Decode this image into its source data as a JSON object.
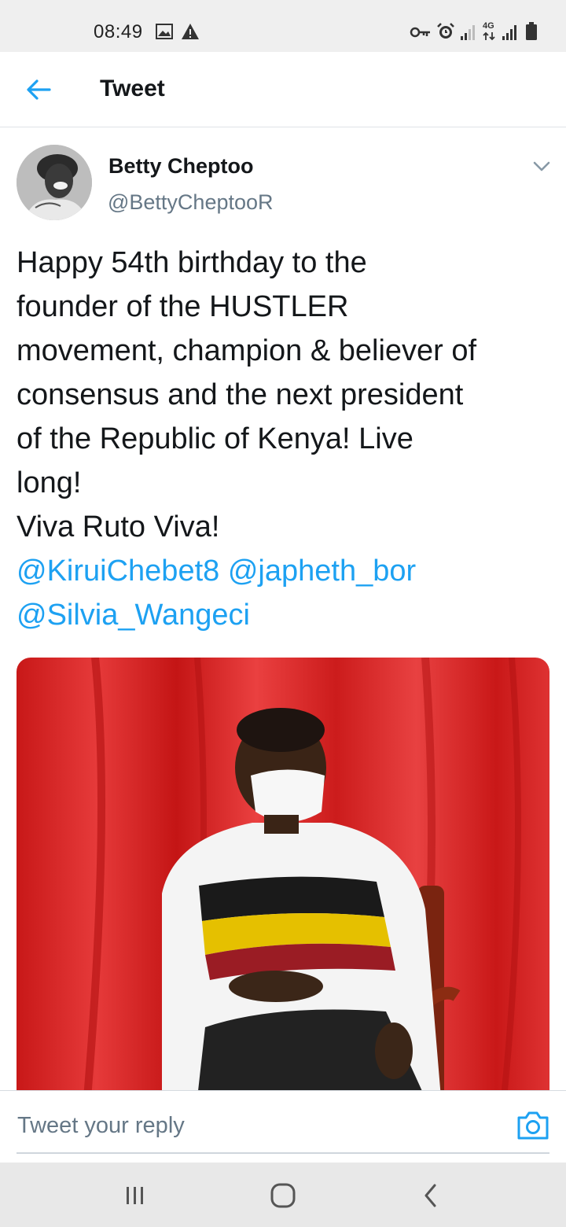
{
  "status_bar": {
    "time": "08:49",
    "network_label": "4G",
    "icons": [
      "image-icon",
      "alert-icon",
      "key-icon",
      "alarm-icon",
      "signal-icon",
      "network-4g-icon",
      "signal-icon",
      "battery-icon"
    ]
  },
  "header": {
    "title": "Tweet",
    "back_icon": "arrow-left-icon"
  },
  "tweet": {
    "author_name": "Betty Cheptoo",
    "author_handle": "@BettyCheptooR",
    "text_lines": [
      "Happy 54th birthday to the",
      "founder of the HUSTLER",
      "movement, champion & believer of",
      "consensus and the next president",
      "of the Republic of Kenya! Live",
      "long!",
      "Viva Ruto Viva!"
    ],
    "mentions": [
      "@KiruiChebet8",
      "@japheth_bor",
      "@Silvia_Wangeci"
    ],
    "menu_icon": "chevron-down-icon"
  },
  "reply": {
    "placeholder": "Tweet your reply",
    "camera_icon": "camera-icon"
  },
  "nav": {
    "icons": [
      "recents-icon",
      "home-icon",
      "back-icon"
    ]
  },
  "colors": {
    "accent": "#1da1f2",
    "text": "#14171a",
    "secondary": "#657786",
    "status_bar_bg": "#efefef",
    "nav_bar_bg": "#e8e8e8"
  }
}
